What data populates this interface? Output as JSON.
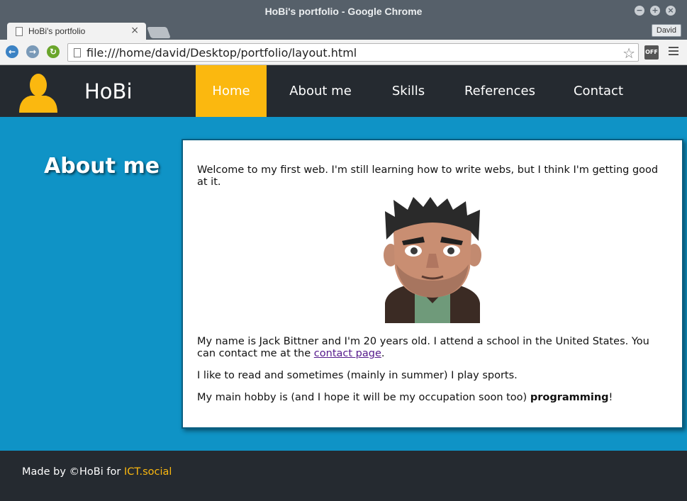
{
  "window": {
    "title": "HoBi's portfolio - Google Chrome",
    "controls": [
      "−",
      "+",
      "×"
    ]
  },
  "tabs": [
    {
      "label": "HoBi's portfolio",
      "close": "×"
    }
  ],
  "profile": {
    "name": "David"
  },
  "toolbar": {
    "url": "file:///home/david/Desktop/portfolio/layout.html",
    "extension_label": "OFF"
  },
  "site": {
    "name": "HoBi",
    "accent_color": "#fbb80f",
    "header_color": "#252a30",
    "main_color": "#0f93c6",
    "nav": [
      {
        "label": "Home",
        "active": true
      },
      {
        "label": "About me",
        "active": false
      },
      {
        "label": "Skills",
        "active": false
      },
      {
        "label": "References",
        "active": false
      },
      {
        "label": "Contact",
        "active": false
      }
    ]
  },
  "aside": {
    "title": "About me"
  },
  "content": {
    "intro": "Welcome to my first web. I'm still learning how to write webs, but I think I'm getting good at it.",
    "bio_before_link": "My name is Jack Bittner and I'm 20 years old. I attend a school in the United States. You can contact me at the ",
    "bio_link": "contact page",
    "bio_after_link": ".",
    "hobbies": "I like to read and sometimes (mainly in summer) I play sports.",
    "main_hobby_before": "My main hobby is (and I hope it will be my occupation soon too) ",
    "main_hobby_bold": "programming",
    "main_hobby_after": "!"
  },
  "footer": {
    "text_before": "Made by ©HoBi for ",
    "link": "ICT.social"
  }
}
